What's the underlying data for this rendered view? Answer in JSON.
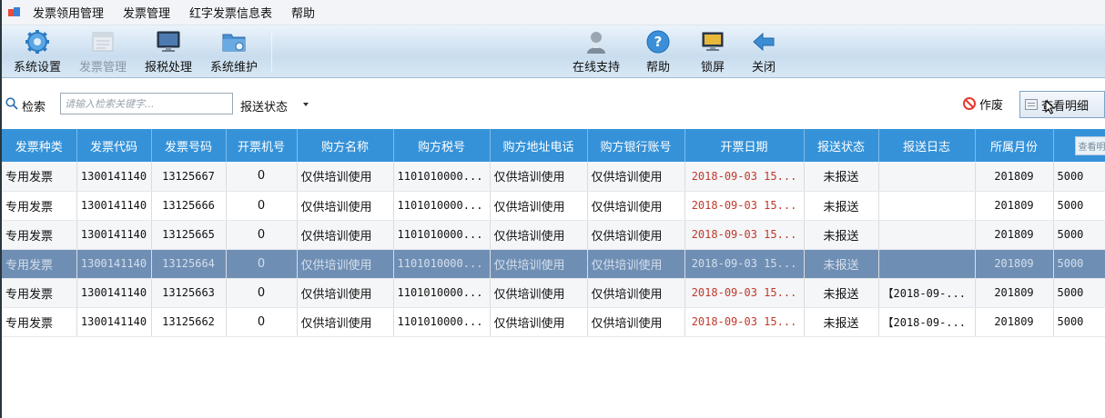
{
  "menu": {
    "items": [
      "发票领用管理",
      "发票管理",
      "红字发票信息表",
      "帮助"
    ]
  },
  "toolbar": {
    "left": [
      {
        "label": "系统设置",
        "icon": "gear-icon",
        "disabled": false
      },
      {
        "label": "发票管理",
        "icon": "invoice-folder-icon",
        "disabled": true
      },
      {
        "label": "报税处理",
        "icon": "monitor-icon",
        "disabled": false
      },
      {
        "label": "系统维护",
        "icon": "maintenance-folder-icon",
        "disabled": false
      }
    ],
    "right": [
      {
        "label": "在线支持",
        "icon": "support-person-icon"
      },
      {
        "label": "帮助",
        "icon": "help-icon"
      },
      {
        "label": "锁屏",
        "icon": "lock-screen-icon"
      },
      {
        "label": "关闭",
        "icon": "close-arrow-icon"
      }
    ]
  },
  "search": {
    "label": "检索",
    "placeholder": "请输入检索关键字...",
    "status_filter": "报送状态",
    "void_label": "作废",
    "detail_label": "查看明细"
  },
  "table": {
    "columns": [
      "发票种类",
      "发票代码",
      "发票号码",
      "开票机号",
      "购方名称",
      "购方税号",
      "购方地址电话",
      "购方银行账号",
      "开票日期",
      "报送状态",
      "报送日志",
      "所属月份",
      "查看明"
    ],
    "rows": [
      [
        "专用发票",
        "1300141140",
        "13125667",
        "0",
        "仅供培训使用",
        "1101010000...",
        "仅供培训使用",
        "仅供培训使用",
        "2018-09-03 15...",
        "未报送",
        "",
        "201809",
        "5000"
      ],
      [
        "专用发票",
        "1300141140",
        "13125666",
        "0",
        "仅供培训使用",
        "1101010000...",
        "仅供培训使用",
        "仅供培训使用",
        "2018-09-03 15...",
        "未报送",
        "",
        "201809",
        "5000"
      ],
      [
        "专用发票",
        "1300141140",
        "13125665",
        "0",
        "仅供培训使用",
        "1101010000...",
        "仅供培训使用",
        "仅供培训使用",
        "2018-09-03 15...",
        "未报送",
        "",
        "201809",
        "5000"
      ],
      [
        "专用发票",
        "1300141140",
        "13125664",
        "0",
        "仅供培训使用",
        "1101010000...",
        "仅供培训使用",
        "仅供培训使用",
        "2018-09-03 15...",
        "未报送",
        "",
        "201809",
        "5000"
      ],
      [
        "专用发票",
        "1300141140",
        "13125663",
        "0",
        "仅供培训使用",
        "1101010000...",
        "仅供培训使用",
        "仅供培训使用",
        "2018-09-03 15...",
        "未报送",
        "【2018-09-...",
        "201809",
        "5000"
      ],
      [
        "专用发票",
        "1300141140",
        "13125662",
        "0",
        "仅供培训使用",
        "1101010000...",
        "仅供培训使用",
        "仅供培训使用",
        "2018-09-03 15...",
        "未报送",
        "【2018-09-...",
        "201809",
        "5000"
      ]
    ],
    "selected_row": 3
  },
  "colors": {
    "header_blue": "#3592d9",
    "selected_row": "#6f8eb4",
    "date_red": "#c0392b",
    "toolbar_top": "#eaf3fb"
  }
}
